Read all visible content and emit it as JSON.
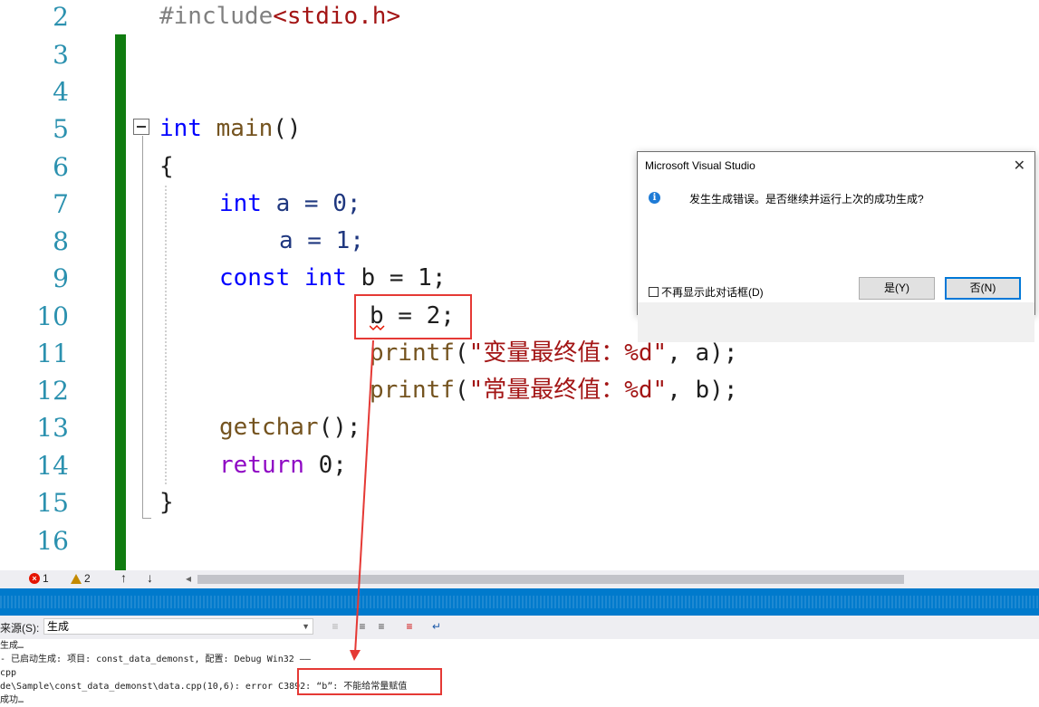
{
  "editor": {
    "line_numbers": [
      "2",
      "3",
      "4",
      "5",
      "6",
      "7",
      "8",
      "9",
      "10",
      "11",
      "12",
      "13",
      "14",
      "15",
      "16"
    ],
    "line2": {
      "directive": "#include",
      "header": "<stdio.h>"
    },
    "line5": {
      "type": "int",
      "name": "main",
      "parens": "()"
    },
    "line6": "{",
    "line7": {
      "type": "int",
      "rest": " a = 0;"
    },
    "line8": "a = 1;",
    "line9": {
      "kw": "const",
      "type": "int",
      "rest": " b = 1;"
    },
    "line10": "b = 2;",
    "line11": {
      "fn": "printf",
      "open": "(",
      "str": "\"变量最终值：%d\"",
      "rest": ", a);"
    },
    "line12": {
      "fn": "printf",
      "open": "(",
      "str": "\"常量最终值：%d\"",
      "rest": ", b);"
    },
    "line13": {
      "fn": "getchar",
      "rest": "();"
    },
    "line14": {
      "kw": "return",
      "rest": " 0;"
    },
    "line15": "}"
  },
  "status": {
    "errors": "1",
    "warnings": "2",
    "up_arrow": "↑",
    "down_arrow": "↓",
    "left_arrow": "◂"
  },
  "output": {
    "source_label": "来源(S):",
    "source_value": "生成",
    "lines": [
      "生成…",
      "- 已启动生成: 项目: const_data_demonst, 配置: Debug Win32 ——",
      "cpp",
      "de\\Sample\\const_data_demonst\\data.cpp(10,6): error C3892: “b”: 不能给常量赋值",
      "成功…"
    ]
  },
  "dialog": {
    "title": "Microsoft Visual Studio",
    "close": "✕",
    "message": "发生生成错误。是否继续并运行上次的成功生成?",
    "yes": "是(Y)",
    "no": "否(N)",
    "checkbox": "不再显示此对话框(D)"
  },
  "colors": {
    "keyword": "#0000ff",
    "control_keyword": "#8f08c4",
    "string": "#a31515",
    "line_number": "#2b91af",
    "highlight_box": "#e53935",
    "change_bar": "#107c10",
    "status_bar": "#007acc"
  },
  "icons": [
    "collapse-icon",
    "error-icon",
    "warning-icon",
    "info-icon",
    "close-icon"
  ]
}
